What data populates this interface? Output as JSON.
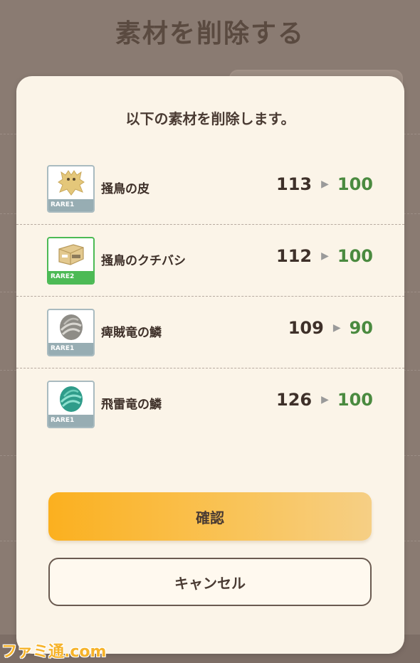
{
  "background": {
    "title": "素材を削除する"
  },
  "dialog": {
    "message": "以下の素材を削除します。",
    "items": [
      {
        "name": "掻鳥の皮",
        "rarity": "RARE1",
        "from": "113",
        "to": "100",
        "icon": "hide-material-icon"
      },
      {
        "name": "掻鳥のクチバシ",
        "rarity": "RARE2",
        "from": "112",
        "to": "100",
        "icon": "beak-material-icon"
      },
      {
        "name": "痺賊竜の鱗",
        "rarity": "RARE1",
        "from": "109",
        "to": "90",
        "icon": "gray-scale-icon"
      },
      {
        "name": "飛雷竜の鱗",
        "rarity": "RARE1",
        "from": "126",
        "to": "100",
        "icon": "teal-scale-icon"
      }
    ],
    "confirm_label": "確認",
    "cancel_label": "キャンセル"
  },
  "watermark": "ファミ通.com",
  "colors": {
    "rare1": "#97adb3",
    "rare2": "#4cba55",
    "count_new": "#4a8a3f",
    "confirm_start": "#fbb01f"
  }
}
